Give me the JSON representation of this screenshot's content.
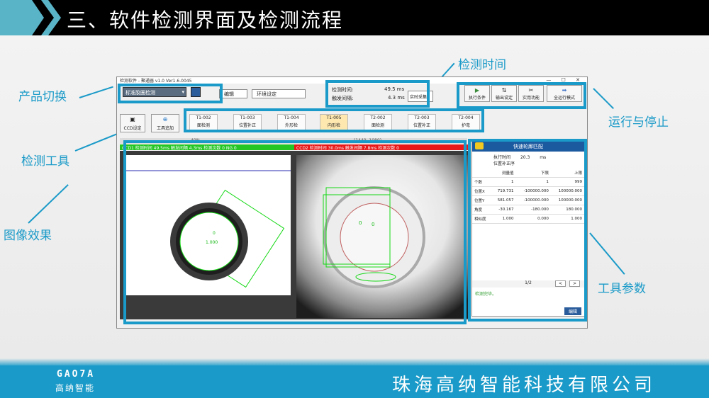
{
  "slide_title": "三、软件检测界面及检测流程",
  "annotations": {
    "product_switch": "产品切换",
    "detect_tool": "检测工具",
    "image_effect": "图像效果",
    "detect_time": "检测时间",
    "run_stop": "运行与停止",
    "tool_params": "工具参数"
  },
  "app": {
    "window_title": "检测软件 - 聚通器 v1.0 Ver1.6.0045",
    "product_combo": "标准胶圈检测",
    "menu_edit": "编辑",
    "menu_env": "环境设定",
    "stat_detect_label": "检测时间:",
    "stat_detect_value": "49.5 ms",
    "stat_trigger_label": "触发间隔:",
    "stat_trigger_value": "4.3 ms",
    "realtime_btn": "实时采集",
    "btn_exec": "执行条件",
    "btn_output": "输出设定",
    "btn_util": "实用功能",
    "btn_fullrun": "全运行模式",
    "ccd_setting": "CCD设定",
    "tool_add": "工具追加",
    "tools": [
      {
        "id": "T1-002",
        "name": "面检测"
      },
      {
        "id": "T1-003",
        "name": "位置补正"
      },
      {
        "id": "T1-004",
        "name": "外形检"
      },
      {
        "id": "T1-005",
        "name": "内形检"
      },
      {
        "id": "T2-002",
        "name": "面检测"
      },
      {
        "id": "T2-003",
        "name": "位置补正"
      },
      {
        "id": "T2-004",
        "name": "护弯"
      }
    ],
    "cam1_bar": "CCD1  检测时间 49.5ms  触发间隔 4.3ms  检测次数 0  NG 0",
    "cam2_bar": "CCD2  检测时间 30.0ms  触发间隔 7.8ms  检测次数 0",
    "cam_zoom": "40%",
    "cam_coord": "(1440, 1080)",
    "cam1_label_a": "0",
    "cam1_label_b": "1.000",
    "panel_header": "快速轮廓匹配",
    "panel_exec_label": "执行时间",
    "panel_exec_value": "20.3",
    "panel_exec_unit": "ms",
    "panel_sub": "位置补正序",
    "param_headers": [
      "",
      "测量值",
      "下限",
      "上限"
    ],
    "param_rows": [
      [
        "个数",
        "1",
        "1",
        "999"
      ],
      [
        "位置X",
        "719.731",
        "-100000.000",
        "100000.000"
      ],
      [
        "位置Y",
        "581.057",
        "-100000.000",
        "100000.000"
      ],
      [
        "角度",
        "-30.167",
        "-180.000",
        "180.000"
      ],
      [
        "相似度",
        "1.000",
        "0.000",
        "1.000"
      ]
    ],
    "param_page": "1/2",
    "param_status": "检测完毕。",
    "param_edit": "编辑"
  },
  "footer": {
    "logo": "GAO7A",
    "logo_sub": "高纳智能",
    "company": "珠海高纳智能科技有限公司"
  },
  "colors": {
    "accent": "#1a9ac8",
    "bar_green": "#24c624",
    "bar_red": "#e81818"
  }
}
